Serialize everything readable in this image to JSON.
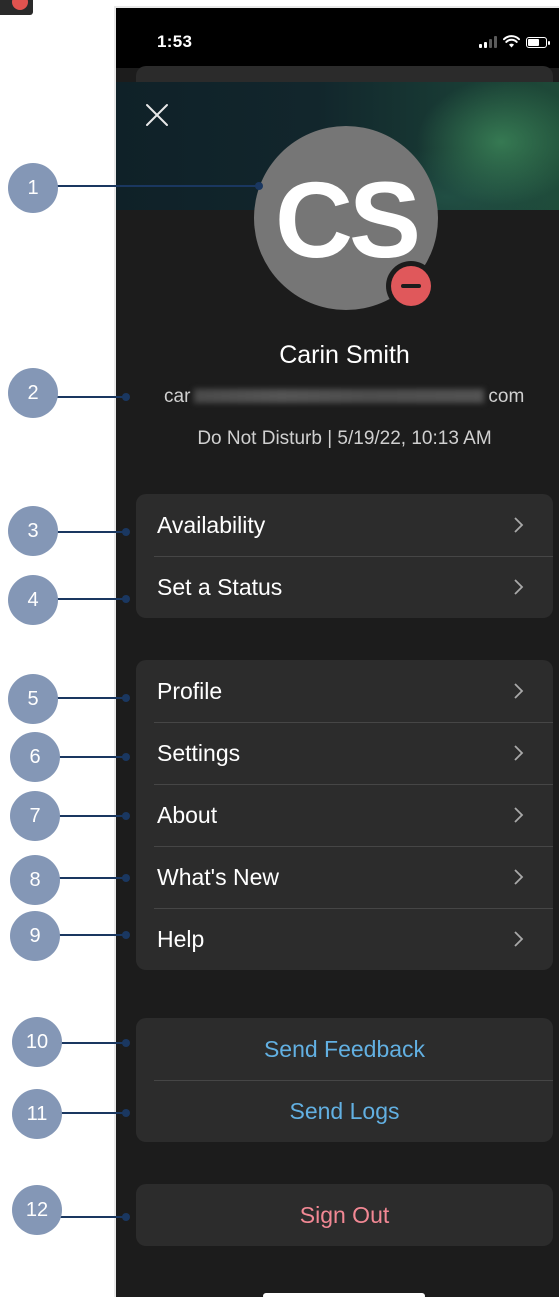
{
  "status_bar": {
    "time": "1:53"
  },
  "profile": {
    "initials": "CS",
    "name": "Carin Smith",
    "email_start": "car",
    "email_end": "com",
    "status_line": "Do Not Disturb | 5/19/22, 10:13 AM",
    "presence": "do-not-disturb",
    "presence_color": "#e0585b"
  },
  "menu": {
    "group1": [
      {
        "label": "Availability"
      },
      {
        "label": "Set a Status"
      }
    ],
    "group2": [
      {
        "label": "Profile"
      },
      {
        "label": "Settings"
      },
      {
        "label": "About"
      },
      {
        "label": "What's New"
      },
      {
        "label": "Help"
      }
    ],
    "group3": [
      {
        "label": "Send Feedback"
      },
      {
        "label": "Send Logs"
      }
    ],
    "sign_out": {
      "label": "Sign Out"
    }
  },
  "callouts": [
    "1",
    "2",
    "3",
    "4",
    "5",
    "6",
    "7",
    "8",
    "9",
    "10",
    "11",
    "12"
  ],
  "colors": {
    "link": "#62b0e2",
    "danger": "#f28894",
    "callout_badge": "#8497b6",
    "callout_line": "#1a3760"
  }
}
